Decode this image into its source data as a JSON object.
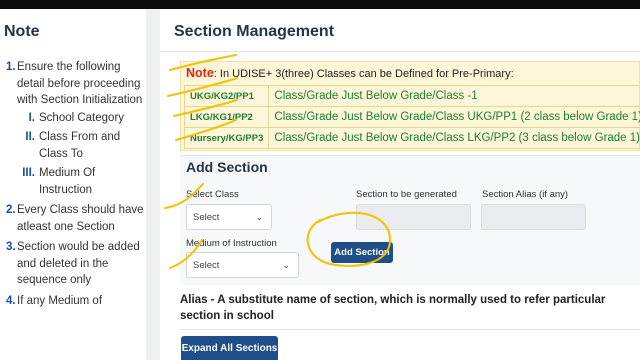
{
  "note_panel": {
    "title": "Note",
    "items": [
      {
        "num": "1.",
        "text": "Ensure the following detail before proceeding with Section Initialization",
        "sub": [
          {
            "num": "I.",
            "text": "School Category"
          },
          {
            "num": "II.",
            "text": "Class From and Class To"
          },
          {
            "num": "III.",
            "text": "Medium Of Instruction"
          }
        ]
      },
      {
        "num": "2.",
        "text": "Every Class should have atleast one Section"
      },
      {
        "num": "3.",
        "text": "Section would be added and deleted in the sequence only"
      },
      {
        "num": "4.",
        "text": "If any Medium of"
      }
    ]
  },
  "main": {
    "title": "Section Management",
    "note": {
      "label": "Note",
      "text": ": In UDISE+ 3(three) Classes can be Defined for Pre-Primary:",
      "rows": [
        {
          "code": "UKG/KG2/PP1",
          "desc": "Class/Grade Just Below Grade/Class -1"
        },
        {
          "code": "LKG/KG1/PP2",
          "desc": "Class/Grade Just Below Grade/Class UKG/PP1 (2 class below Grade 1)"
        },
        {
          "code": "Nursery/KG/PP3",
          "desc": "Class/Grade Just Below Grade/Class LKG/PP2 (3 class below Grade 1)"
        }
      ]
    },
    "add_section": {
      "title": "Add Section",
      "select_class_label": "Select Class",
      "select_class_value": "Select",
      "section_generated_label": "Section to be generated",
      "section_alias_label": "Section Alias (if any)",
      "medium_label": "Medium of Instruction",
      "medium_value": "Select",
      "add_button": "Add Section"
    },
    "alias_text": "Alias - A substitute name of section, which is normally used to refer particular section in school",
    "expand_button": "Expand All Sections"
  },
  "colors": {
    "accent": "#1f4e88",
    "note_label": "#d9261c",
    "note_text": "#1e7d33",
    "note_bg": "#fdf6d8",
    "highlight_annotation": "#f2c200"
  },
  "icons": [
    "chevron-down-icon"
  ]
}
